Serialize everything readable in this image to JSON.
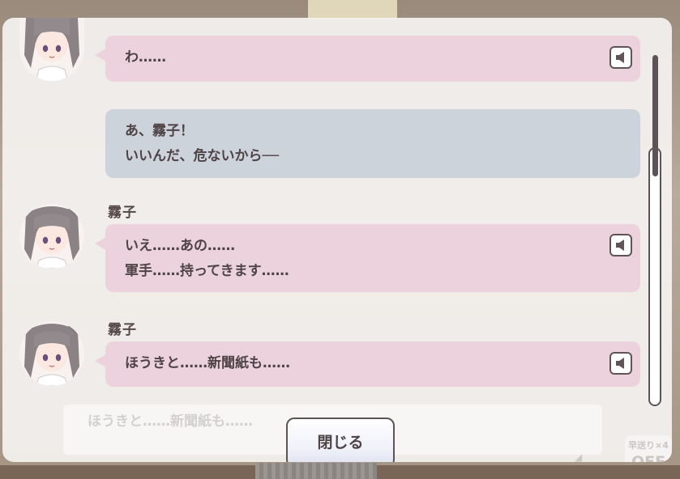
{
  "log": {
    "entries": [
      {
        "speaker": "",
        "lines": [
          "わ……"
        ],
        "style": "pink",
        "has_voice": true,
        "has_avatar": true
      },
      {
        "speaker": "",
        "lines": [
          "あ、霧子！",
          "いいんだ、危ないから──"
        ],
        "style": "grey",
        "has_voice": false,
        "has_avatar": false
      },
      {
        "speaker": "霧子",
        "lines": [
          "いえ……あの……",
          "軍手……持ってきます……"
        ],
        "style": "pink",
        "has_voice": true,
        "has_avatar": true
      },
      {
        "speaker": "霧子",
        "lines": [
          "ほうきと……新聞紙も……"
        ],
        "style": "pink",
        "has_voice": true,
        "has_avatar": true
      }
    ],
    "close_label": "閉じる",
    "voice_icon": "speaker-icon",
    "scroll_position": 0.0
  },
  "background": {
    "ghost_text": "ほうきと……新聞紙も……",
    "speed_label": "早送り×4",
    "speed_state": "OFF"
  },
  "colors": {
    "bubble_pink": "#ebd2dd",
    "bubble_grey": "#cdd3da",
    "text": "#4e4346",
    "outline": "#5d5357"
  }
}
